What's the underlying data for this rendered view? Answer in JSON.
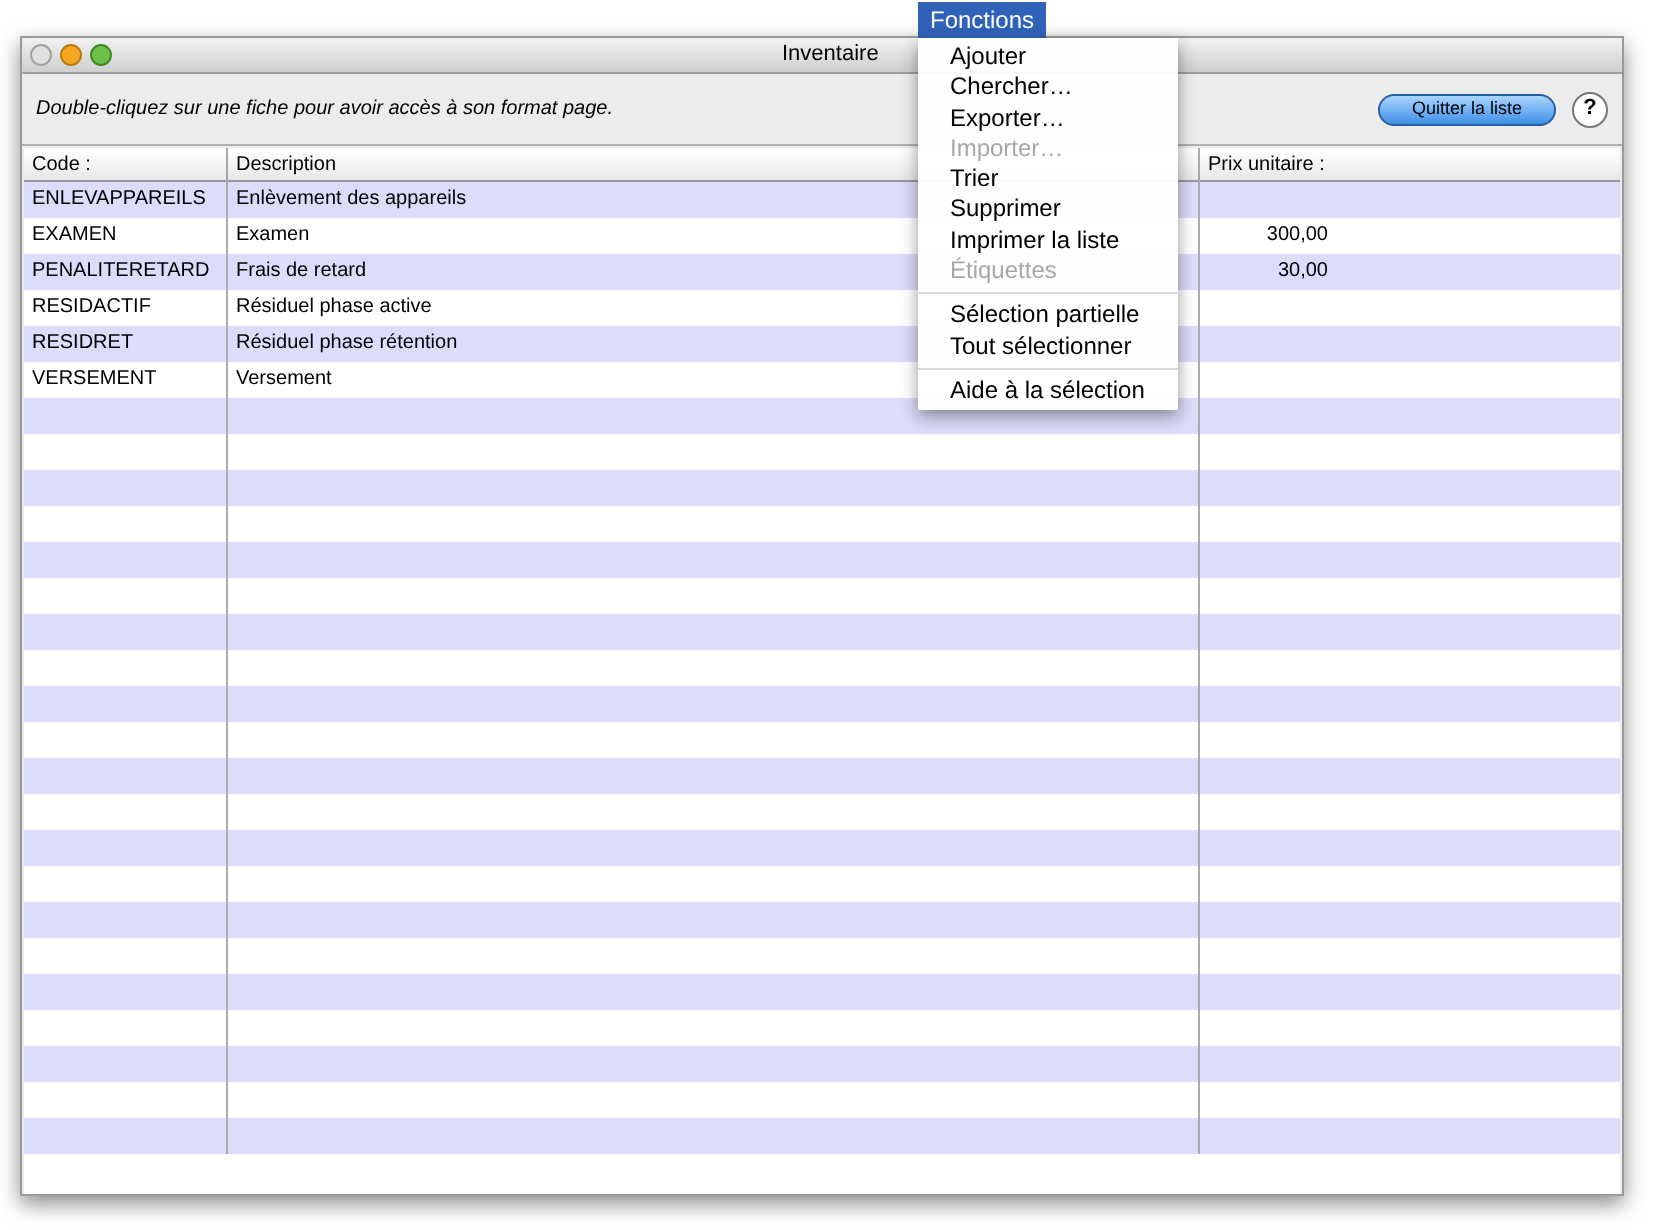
{
  "menu_bar": {
    "label": "Fonctions",
    "selected": true
  },
  "window": {
    "title": "Inventaire"
  },
  "toolbar": {
    "hint": "Double-cliquez sur une fiche pour avoir accès à son format page.",
    "quit_button": "Quitter la liste",
    "help_button": "?"
  },
  "table": {
    "columns": [
      "Code :",
      "Description",
      "Prix unitaire :"
    ],
    "rows": [
      {
        "code": "ENLEVAPPAREILS",
        "description": "Enlèvement des appareils"
      },
      {
        "code": "EXAMEN",
        "description": "Examen",
        "price": "300,00"
      },
      {
        "code": "PENALITERETARD",
        "description": "Frais de retard",
        "price": "30,00"
      },
      {
        "code": "RESIDACTIF",
        "description": "Résiduel phase active"
      },
      {
        "code": "RESIDRET",
        "description": "Résiduel phase rétention"
      },
      {
        "code": "VERSEMENT",
        "description": "Versement"
      }
    ]
  },
  "menu": {
    "groups": [
      [
        {
          "label": "Ajouter",
          "disabled": false
        },
        {
          "label": "Chercher…",
          "disabled": false
        },
        {
          "label": "Exporter…",
          "disabled": false
        },
        {
          "label": "Importer…",
          "disabled": true
        },
        {
          "label": "Trier",
          "disabled": false
        },
        {
          "label": "Supprimer",
          "disabled": false
        },
        {
          "label": "Imprimer la liste",
          "disabled": false
        },
        {
          "label": "Étiquettes",
          "disabled": true
        }
      ],
      [
        {
          "label": "Sélection partielle",
          "disabled": false
        },
        {
          "label": "Tout sélectionner",
          "disabled": false
        }
      ],
      [
        {
          "label": "Aide à la sélection",
          "disabled": false
        }
      ]
    ]
  }
}
